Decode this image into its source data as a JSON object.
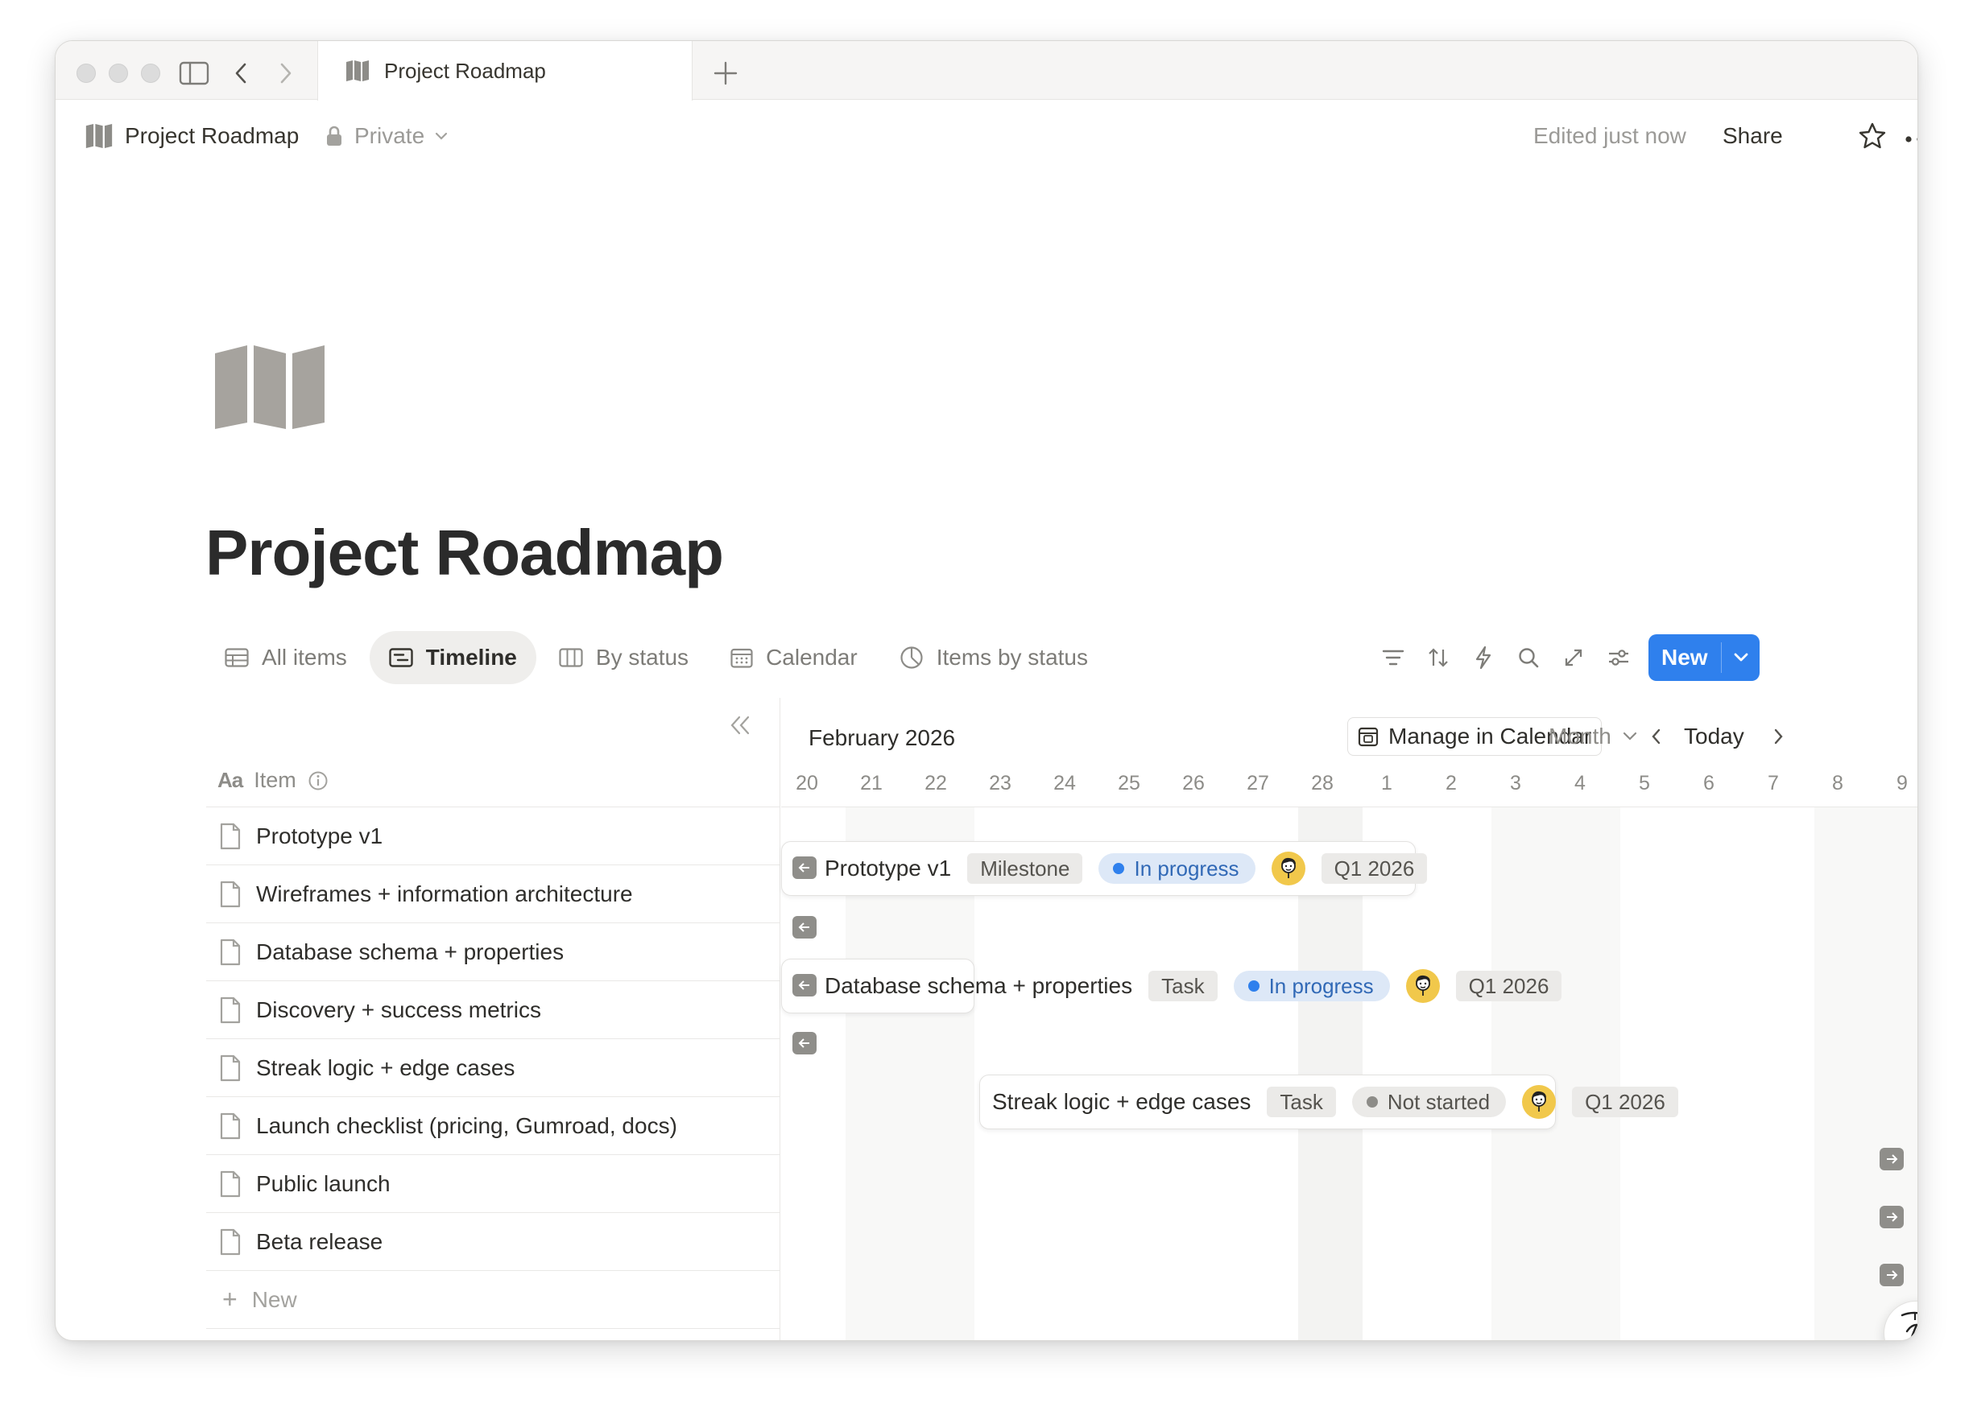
{
  "window": {
    "tab_title": "Project Roadmap"
  },
  "topbar": {
    "breadcrumb_title": "Project Roadmap",
    "privacy_label": "Private",
    "edited_label": "Edited just now",
    "share_label": "Share"
  },
  "page": {
    "title": "Project Roadmap",
    "icon": "map-icon"
  },
  "views": [
    {
      "label": "All items",
      "icon": "table-icon"
    },
    {
      "label": "Timeline",
      "icon": "timeline-icon",
      "active": true
    },
    {
      "label": "By status",
      "icon": "board-icon"
    },
    {
      "label": "Calendar",
      "icon": "calendar-icon"
    },
    {
      "label": "Items by status",
      "icon": "chart-icon"
    }
  ],
  "toolbar": {
    "new_label": "New",
    "tools": [
      "filter-icon",
      "sort-icon",
      "automation-icon",
      "search-icon",
      "expand-icon",
      "settings-icon"
    ]
  },
  "list": {
    "header_label": "Item",
    "header_type_label": "Aa",
    "rows": [
      "Prototype v1",
      "Wireframes + information architecture",
      "Database schema + properties",
      "Discovery + success metrics",
      "Streak logic + edge cases",
      "Launch checklist (pricing, Gumroad, docs)",
      "Public launch",
      "Beta release"
    ],
    "new_label": "New"
  },
  "timeline": {
    "month_label": "February 2026",
    "manage_label": "Manage in Calendar",
    "scale_label": "Month",
    "today_label": "Today",
    "days": [
      "20",
      "21",
      "22",
      "23",
      "24",
      "25",
      "26",
      "27",
      "28",
      "1",
      "2",
      "3",
      "4",
      "5",
      "6",
      "7",
      "8",
      "9"
    ],
    "bars": [
      {
        "title": "Prototype v1",
        "type": "Milestone",
        "status": "In progress",
        "quarter": "Q1 2026"
      },
      {
        "title": "Database schema + properties",
        "type": "Task",
        "status": "In progress",
        "quarter": "Q1 2026"
      },
      {
        "title": "Streak logic + edge cases",
        "type": "Task",
        "status": "Not started",
        "quarter": "Q1 2026"
      }
    ]
  },
  "colors": {
    "accent": "#2f80ed",
    "in_progress_bg": "#dde8f7",
    "in_progress_text": "#3169b6",
    "chip_bg": "#ebeae8",
    "text_primary": "#2f2e2b",
    "text_secondary": "#8d8c88"
  }
}
